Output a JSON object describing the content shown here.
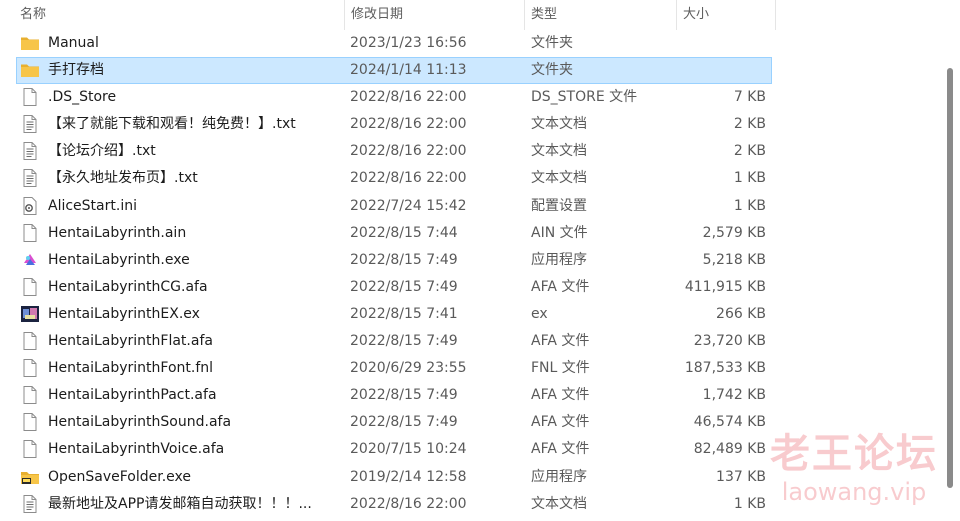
{
  "columns": {
    "name": "名称",
    "date": "修改日期",
    "type": "类型",
    "size": "大小"
  },
  "files": [
    {
      "name": "Manual",
      "date": "2023/1/23 16:56",
      "type": "文件夹",
      "size": "",
      "icon": "folder-icon",
      "selected": false
    },
    {
      "name": "手打存档",
      "date": "2024/1/14 11:13",
      "type": "文件夹",
      "size": "",
      "icon": "folder-icon",
      "selected": true
    },
    {
      "name": ".DS_Store",
      "date": "2022/8/16 22:00",
      "type": "DS_STORE 文件",
      "size": "7 KB",
      "icon": "blank-file-icon",
      "selected": false
    },
    {
      "name": "【来了就能下载和观看！纯免费！】.txt",
      "date": "2022/8/16 22:00",
      "type": "文本文档",
      "size": "2 KB",
      "icon": "text-file-icon",
      "selected": false
    },
    {
      "name": "【论坛介绍】.txt",
      "date": "2022/8/16 22:00",
      "type": "文本文档",
      "size": "2 KB",
      "icon": "text-file-icon",
      "selected": false
    },
    {
      "name": "【永久地址发布页】.txt",
      "date": "2022/8/16 22:00",
      "type": "文本文档",
      "size": "1 KB",
      "icon": "text-file-icon",
      "selected": false
    },
    {
      "name": "AliceStart.ini",
      "date": "2022/7/24 15:42",
      "type": "配置设置",
      "size": "1 KB",
      "icon": "settings-file-icon",
      "selected": false
    },
    {
      "name": "HentaiLabyrinth.ain",
      "date": "2022/8/15 7:44",
      "type": "AIN 文件",
      "size": "2,579 KB",
      "icon": "blank-file-icon",
      "selected": false
    },
    {
      "name": "HentaiLabyrinth.exe",
      "date": "2022/8/15 7:49",
      "type": "应用程序",
      "size": "5,218 KB",
      "icon": "app-exe-icon",
      "selected": false
    },
    {
      "name": "HentaiLabyrinthCG.afa",
      "date": "2022/8/15 7:49",
      "type": "AFA 文件",
      "size": "411,915 KB",
      "icon": "blank-file-icon",
      "selected": false
    },
    {
      "name": "HentaiLabyrinthEX.ex",
      "date": "2022/8/15 7:41",
      "type": "ex",
      "size": "266 KB",
      "icon": "image-thumb-icon",
      "selected": false
    },
    {
      "name": "HentaiLabyrinthFlat.afa",
      "date": "2022/8/15 7:49",
      "type": "AFA 文件",
      "size": "23,720 KB",
      "icon": "blank-file-icon",
      "selected": false
    },
    {
      "name": "HentaiLabyrinthFont.fnl",
      "date": "2020/6/29 23:55",
      "type": "FNL 文件",
      "size": "187,533 KB",
      "icon": "blank-file-icon",
      "selected": false
    },
    {
      "name": "HentaiLabyrinthPact.afa",
      "date": "2022/8/15 7:49",
      "type": "AFA 文件",
      "size": "1,742 KB",
      "icon": "blank-file-icon",
      "selected": false
    },
    {
      "name": "HentaiLabyrinthSound.afa",
      "date": "2022/8/15 7:49",
      "type": "AFA 文件",
      "size": "46,574 KB",
      "icon": "blank-file-icon",
      "selected": false
    },
    {
      "name": "HentaiLabyrinthVoice.afa",
      "date": "2020/7/15 10:24",
      "type": "AFA 文件",
      "size": "82,489 KB",
      "icon": "blank-file-icon",
      "selected": false
    },
    {
      "name": "OpenSaveFolder.exe",
      "date": "2019/2/14 12:58",
      "type": "应用程序",
      "size": "137 KB",
      "icon": "folder-exe-icon",
      "selected": false
    },
    {
      "name": "最新地址及APP请发邮箱自动获取！！！...",
      "date": "2022/8/16 22:00",
      "type": "文本文档",
      "size": "1 KB",
      "icon": "text-file-icon",
      "selected": false
    }
  ],
  "watermark": {
    "cn": "老王论坛",
    "en": "laowang.vip"
  },
  "colors": {
    "selection": "#cce8ff",
    "selection_border": "#99d1ff",
    "folder": "#f7c548",
    "watermark": "#e64650"
  }
}
